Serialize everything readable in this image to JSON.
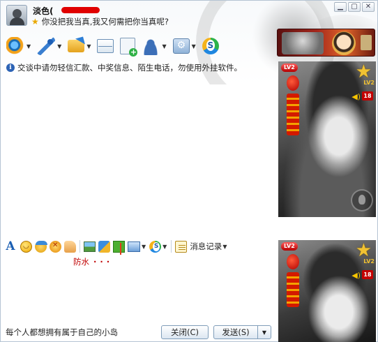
{
  "window": {
    "controls": [
      "▁",
      "▢",
      "✕"
    ]
  },
  "contact": {
    "name": "淡色(",
    "signature": "你没把我当真,我又何需把你当真呢?"
  },
  "toolbar": {
    "items": [
      {
        "icon": "video-call-icon",
        "has_dropdown": true
      },
      {
        "icon": "voice-call-icon",
        "has_dropdown": true
      },
      {
        "icon": "send-file-icon",
        "has_dropdown": true
      },
      {
        "icon": "send-sms-icon",
        "has_dropdown": false
      },
      {
        "icon": "create-group-icon",
        "has_dropdown": false
      },
      {
        "icon": "contact-info-icon",
        "has_dropdown": true
      },
      {
        "icon": "app-settings-icon",
        "has_dropdown": true
      },
      {
        "icon": "soso-icon",
        "has_dropdown": false
      }
    ],
    "dropdown_glyph": "▼"
  },
  "notice": {
    "icon": "info-icon",
    "text": "交谈中请勿轻信汇款、中奖信息、陌生电话，勿使用外挂软件。"
  },
  "show_panel": {
    "badge_label": "LV2",
    "star_label": "LV2",
    "count": "18"
  },
  "input_toolbar": {
    "history_label": "消息记录",
    "dropdown_glyph": "▼"
  },
  "input": {
    "text": "防水",
    "trailing": "···"
  },
  "footer": {
    "motto": "每个人都想拥有属于自己的小岛",
    "close_label": "关闭(C)",
    "send_label": "发送(S)",
    "send_arrow": "▼"
  },
  "colors": {
    "accent": "#2c63b5",
    "input_text": "#c00000",
    "button_border": "#7f9db9"
  }
}
